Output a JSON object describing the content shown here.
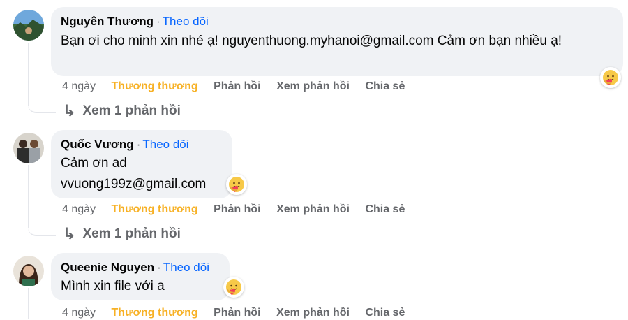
{
  "comments": [
    {
      "author": "Nguyên Thương",
      "follow_label": "Theo dõi",
      "text": "Bạn ơi cho minh xin nhé ạ! nguyenthuong.myhanoi@gmail.com Cảm ơn bạn nhiều ạ!",
      "reaction": "care-emoji",
      "time": "4 ngày",
      "reacted_label": "Thương thương",
      "reply_label": "Phản hồi",
      "view_replies_label": "Xem phản hồi",
      "share_label": "Chia sẻ",
      "more_replies": "Xem 1 phản hồi"
    },
    {
      "author": "Quốc Vương",
      "follow_label": "Theo dõi",
      "text_line1": "Cảm ơn ad",
      "text_line2": "vvuong199z@gmail.com",
      "reaction": "care-emoji",
      "time": "4 ngày",
      "reacted_label": "Thương thương",
      "reply_label": "Phản hồi",
      "view_replies_label": "Xem phản hồi",
      "share_label": "Chia sẻ",
      "more_replies": "Xem 1 phản hồi"
    },
    {
      "author": "Queenie Nguyen",
      "follow_label": "Theo dõi",
      "text": "Mình xin file với a",
      "reaction": "care-emoji",
      "time": "4 ngày",
      "reacted_label": "Thương thương",
      "reply_label": "Phản hồi",
      "view_replies_label": "Xem phản hồi",
      "share_label": "Chia sẻ"
    }
  ],
  "colors": {
    "bubble": "#f0f2f5",
    "follow": "#0866ff",
    "reacted": "#f7b125",
    "muted": "#65676b"
  }
}
